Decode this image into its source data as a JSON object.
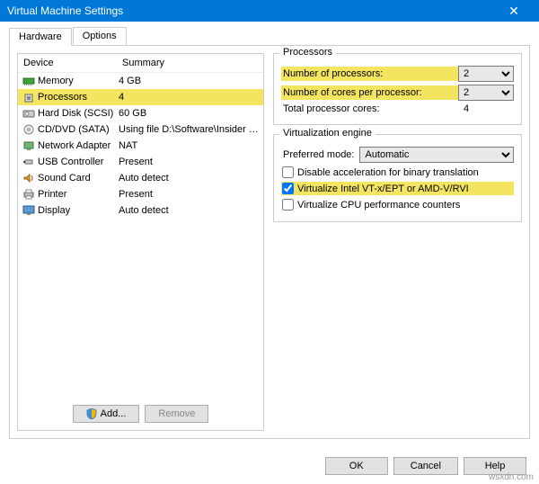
{
  "window": {
    "title": "Virtual Machine Settings",
    "close": "✕"
  },
  "tabs": {
    "hardware": "Hardware",
    "options": "Options"
  },
  "list": {
    "header_device": "Device",
    "header_summary": "Summary",
    "items": [
      {
        "name": "Memory",
        "summary": "4 GB",
        "icon": "memory"
      },
      {
        "name": "Processors",
        "summary": "4",
        "icon": "cpu",
        "selected": true
      },
      {
        "name": "Hard Disk (SCSI)",
        "summary": "60 GB",
        "icon": "hdd"
      },
      {
        "name": "CD/DVD (SATA)",
        "summary": "Using file D:\\Software\\Insider Previe...",
        "icon": "cd"
      },
      {
        "name": "Network Adapter",
        "summary": "NAT",
        "icon": "net"
      },
      {
        "name": "USB Controller",
        "summary": "Present",
        "icon": "usb"
      },
      {
        "name": "Sound Card",
        "summary": "Auto detect",
        "icon": "sound"
      },
      {
        "name": "Printer",
        "summary": "Present",
        "icon": "printer"
      },
      {
        "name": "Display",
        "summary": "Auto detect",
        "icon": "display"
      }
    ]
  },
  "buttons": {
    "add": "Add...",
    "remove": "Remove",
    "ok": "OK",
    "cancel": "Cancel",
    "help": "Help"
  },
  "processors": {
    "legend": "Processors",
    "num_label": "Number of processors:",
    "num_value": "2",
    "cores_label": "Number of cores per processor:",
    "cores_value": "2",
    "total_label": "Total processor cores:",
    "total_value": "4"
  },
  "virt": {
    "legend": "Virtualization engine",
    "pref_label": "Preferred mode:",
    "pref_value": "Automatic",
    "cb_disable": "Disable acceleration for binary translation",
    "cb_vtx": "Virtualize Intel VT-x/EPT or AMD-V/RVI",
    "cb_perf": "Virtualize CPU performance counters"
  },
  "watermark": "wsxdn.com"
}
